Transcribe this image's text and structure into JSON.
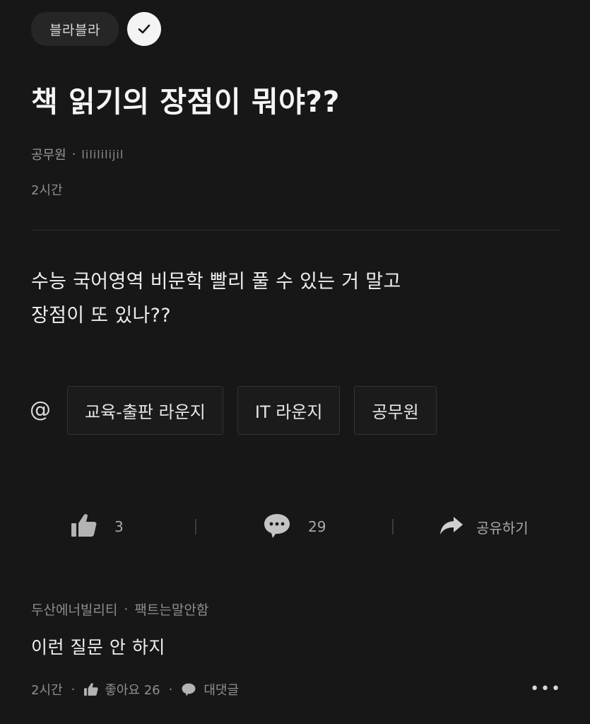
{
  "header": {
    "topic_label": "블라블라"
  },
  "post": {
    "title": "책 읽기의 장점이 뭐야??",
    "author_company": "공무원",
    "author_nickname": "lilililijil",
    "time": "2시간",
    "body_line1": "수능 국어영역 비문학 빨리 풀 수 있는 거 말고",
    "body_line2": "장점이 또 있나??",
    "at_symbol": "@",
    "lounges": [
      "교육-출판 라운지",
      "IT 라운지",
      "공무원"
    ]
  },
  "actions": {
    "like_count": "3",
    "comment_count": "29",
    "share_label": "공유하기"
  },
  "comment": {
    "author_company": "두산에너빌리티",
    "author_nickname": "팩트는말안함",
    "text": "이런 질문 안 하지",
    "time": "2시간",
    "like_label": "좋아요 26",
    "reply_label": "대댓글",
    "more": "•••"
  },
  "colors": {
    "background": "#171717",
    "chip_background": "#262626",
    "muted_text": "#8e8e8e"
  }
}
